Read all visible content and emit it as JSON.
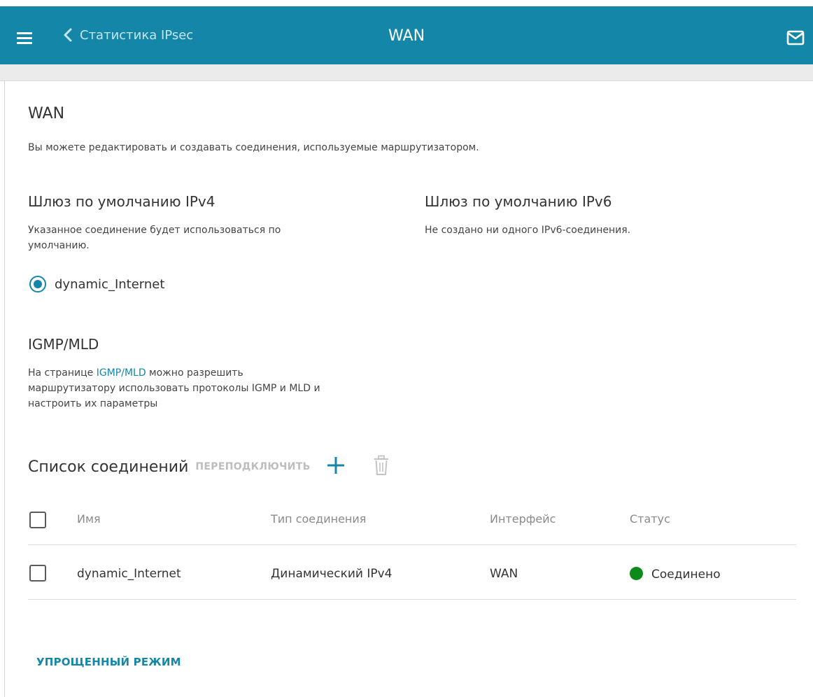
{
  "header": {
    "back_label": "Статистика IPsec",
    "title": "WAN",
    "icons": [
      "menu-icon",
      "chevron-left-icon",
      "mail-icon"
    ],
    "bar_color": "#1487a9"
  },
  "page": {
    "title": "WAN",
    "intro": "Вы можете редактировать и создавать соединения, используемые маршрутизатором."
  },
  "gateway_ipv4": {
    "title": "Шлюз по умолчанию IPv4",
    "description_line1": "Указанное соединение будет использоваться по",
    "description_line2": "умолчанию.",
    "selected": "dynamic_Internet"
  },
  "gateway_ipv6": {
    "title": "Шлюз по умолчанию IPv6",
    "description": "Не создано ни одного IPv6-соединения."
  },
  "igmp": {
    "title": "IGMP/MLD",
    "text_before_link": "На странице ",
    "link": "IGMP/MLD",
    "text_after_link": " можно разрешить",
    "line2": "маршрутизатору использовать протоколы IGMP и MLD и",
    "line3": "настроить их параметры"
  },
  "connections": {
    "title": "Список соединений",
    "reconnect_label": "ПЕРЕПОДКЛЮЧИТЬ",
    "columns": [
      "Имя",
      "Тип соединения",
      "Интерфейс",
      "Статус"
    ],
    "rows": [
      {
        "name": "dynamic_Internet",
        "type": "Динамический IPv4",
        "interface": "WAN",
        "status": "Соединено",
        "status_color": "#0c8b1c"
      }
    ]
  },
  "footer": {
    "simple_mode": "УПРОЩЕННЫЙ РЕЖИМ"
  }
}
